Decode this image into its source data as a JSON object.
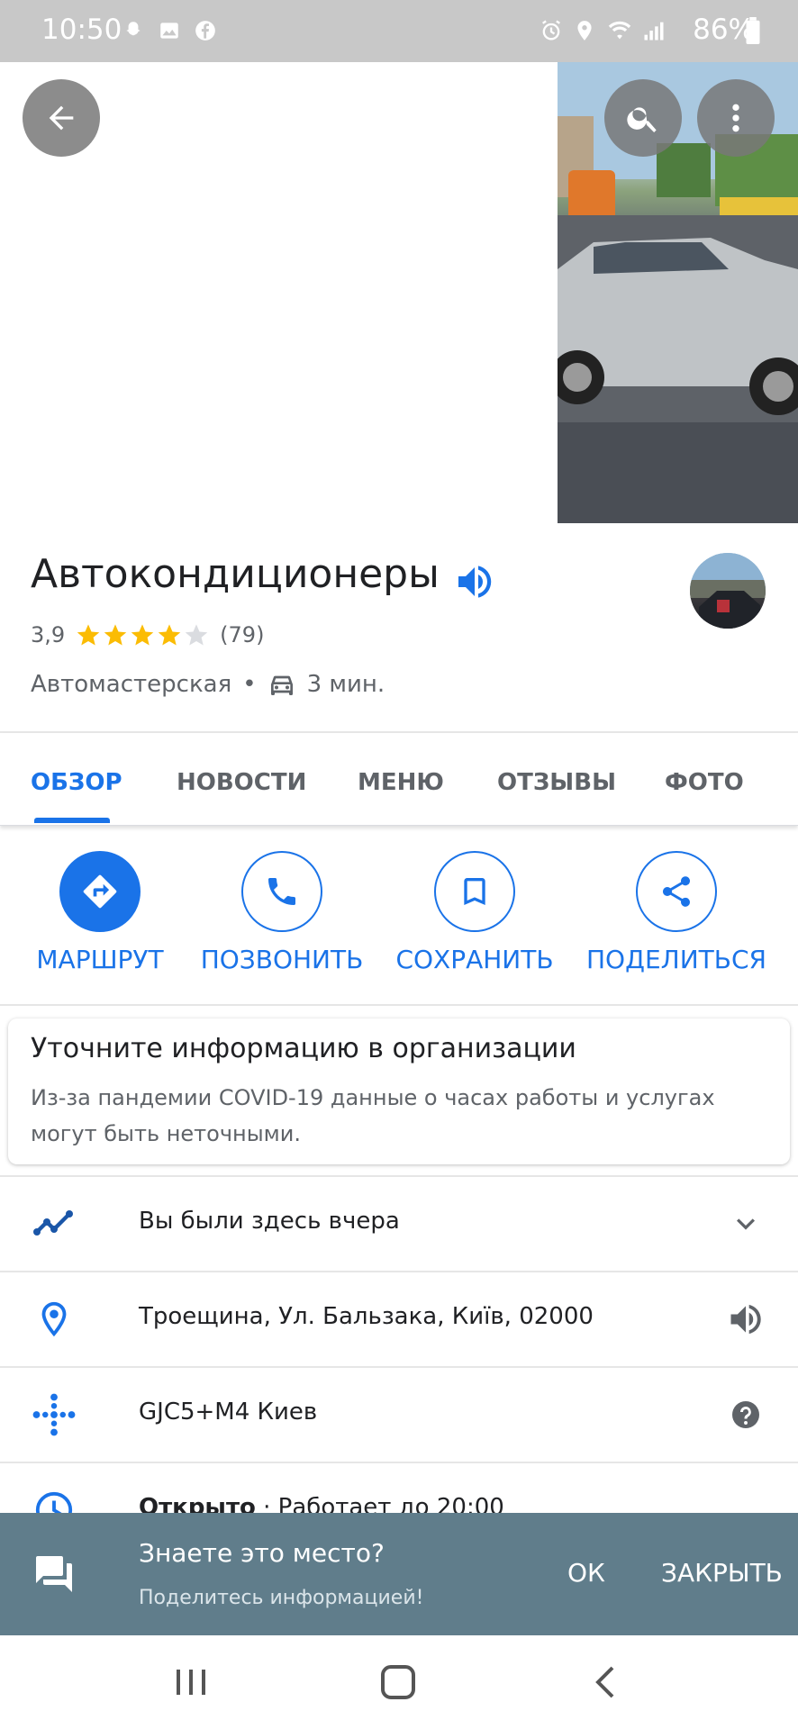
{
  "status_bar": {
    "time": "10:50",
    "battery": "86%",
    "left_icons": [
      "snapchat-icon",
      "image-icon",
      "facebook-icon"
    ],
    "right_icons": [
      "alarm-icon",
      "location-icon",
      "wifi-icon",
      "signal-icon",
      "battery-icon"
    ]
  },
  "top_bar": {
    "back_icon": "arrow-back-icon",
    "search_icon": "search-icon",
    "more_icon": "more-vert-icon"
  },
  "place": {
    "name": "Автокондиционеры",
    "rating_value": "3,9",
    "rating": 3.9,
    "stars_max": 5,
    "reviews_count": "(79)",
    "category": "Автомастерская",
    "separator": "•",
    "drive_time": "3 мин."
  },
  "tabs": [
    {
      "label": "ОБЗОР",
      "active": true
    },
    {
      "label": "НОВОСТИ",
      "active": false
    },
    {
      "label": "МЕНЮ",
      "active": false
    },
    {
      "label": "ОТЗЫВЫ",
      "active": false
    },
    {
      "label": "ФОТО",
      "active": false
    }
  ],
  "actions": [
    {
      "label": "МАРШРУТ",
      "icon": "directions-icon"
    },
    {
      "label": "ПОЗВОНИТЬ",
      "icon": "phone-icon"
    },
    {
      "label": "СОХРАНИТЬ",
      "icon": "bookmark-icon"
    },
    {
      "label": "ПОДЕЛИТЬСЯ",
      "icon": "share-icon"
    }
  ],
  "notice": {
    "title": "Уточните информацию в организации",
    "text": "Из-за пандемии COVID-19 данные о часах работы и услугах могут быть неточными."
  },
  "info_rows": {
    "visited": "Вы были здесь вчера",
    "address": "Троещина, Ул. Бальзака, Київ, 02000",
    "plus_code": "GJC5+M4 Киев",
    "hours_status": "Открыто",
    "hours_detail": "Работает до 20:00"
  },
  "snackbar": {
    "title": "Знаете это место?",
    "subtitle": "Поделитесь информацией!",
    "ok_label": "ОК",
    "close_label": "ЗАКРЫТЬ"
  },
  "colors": {
    "accent": "#1a73e8",
    "star": "#fbbc04",
    "snackbar": "#607d8b",
    "status_bar": "#c8c8c8"
  }
}
